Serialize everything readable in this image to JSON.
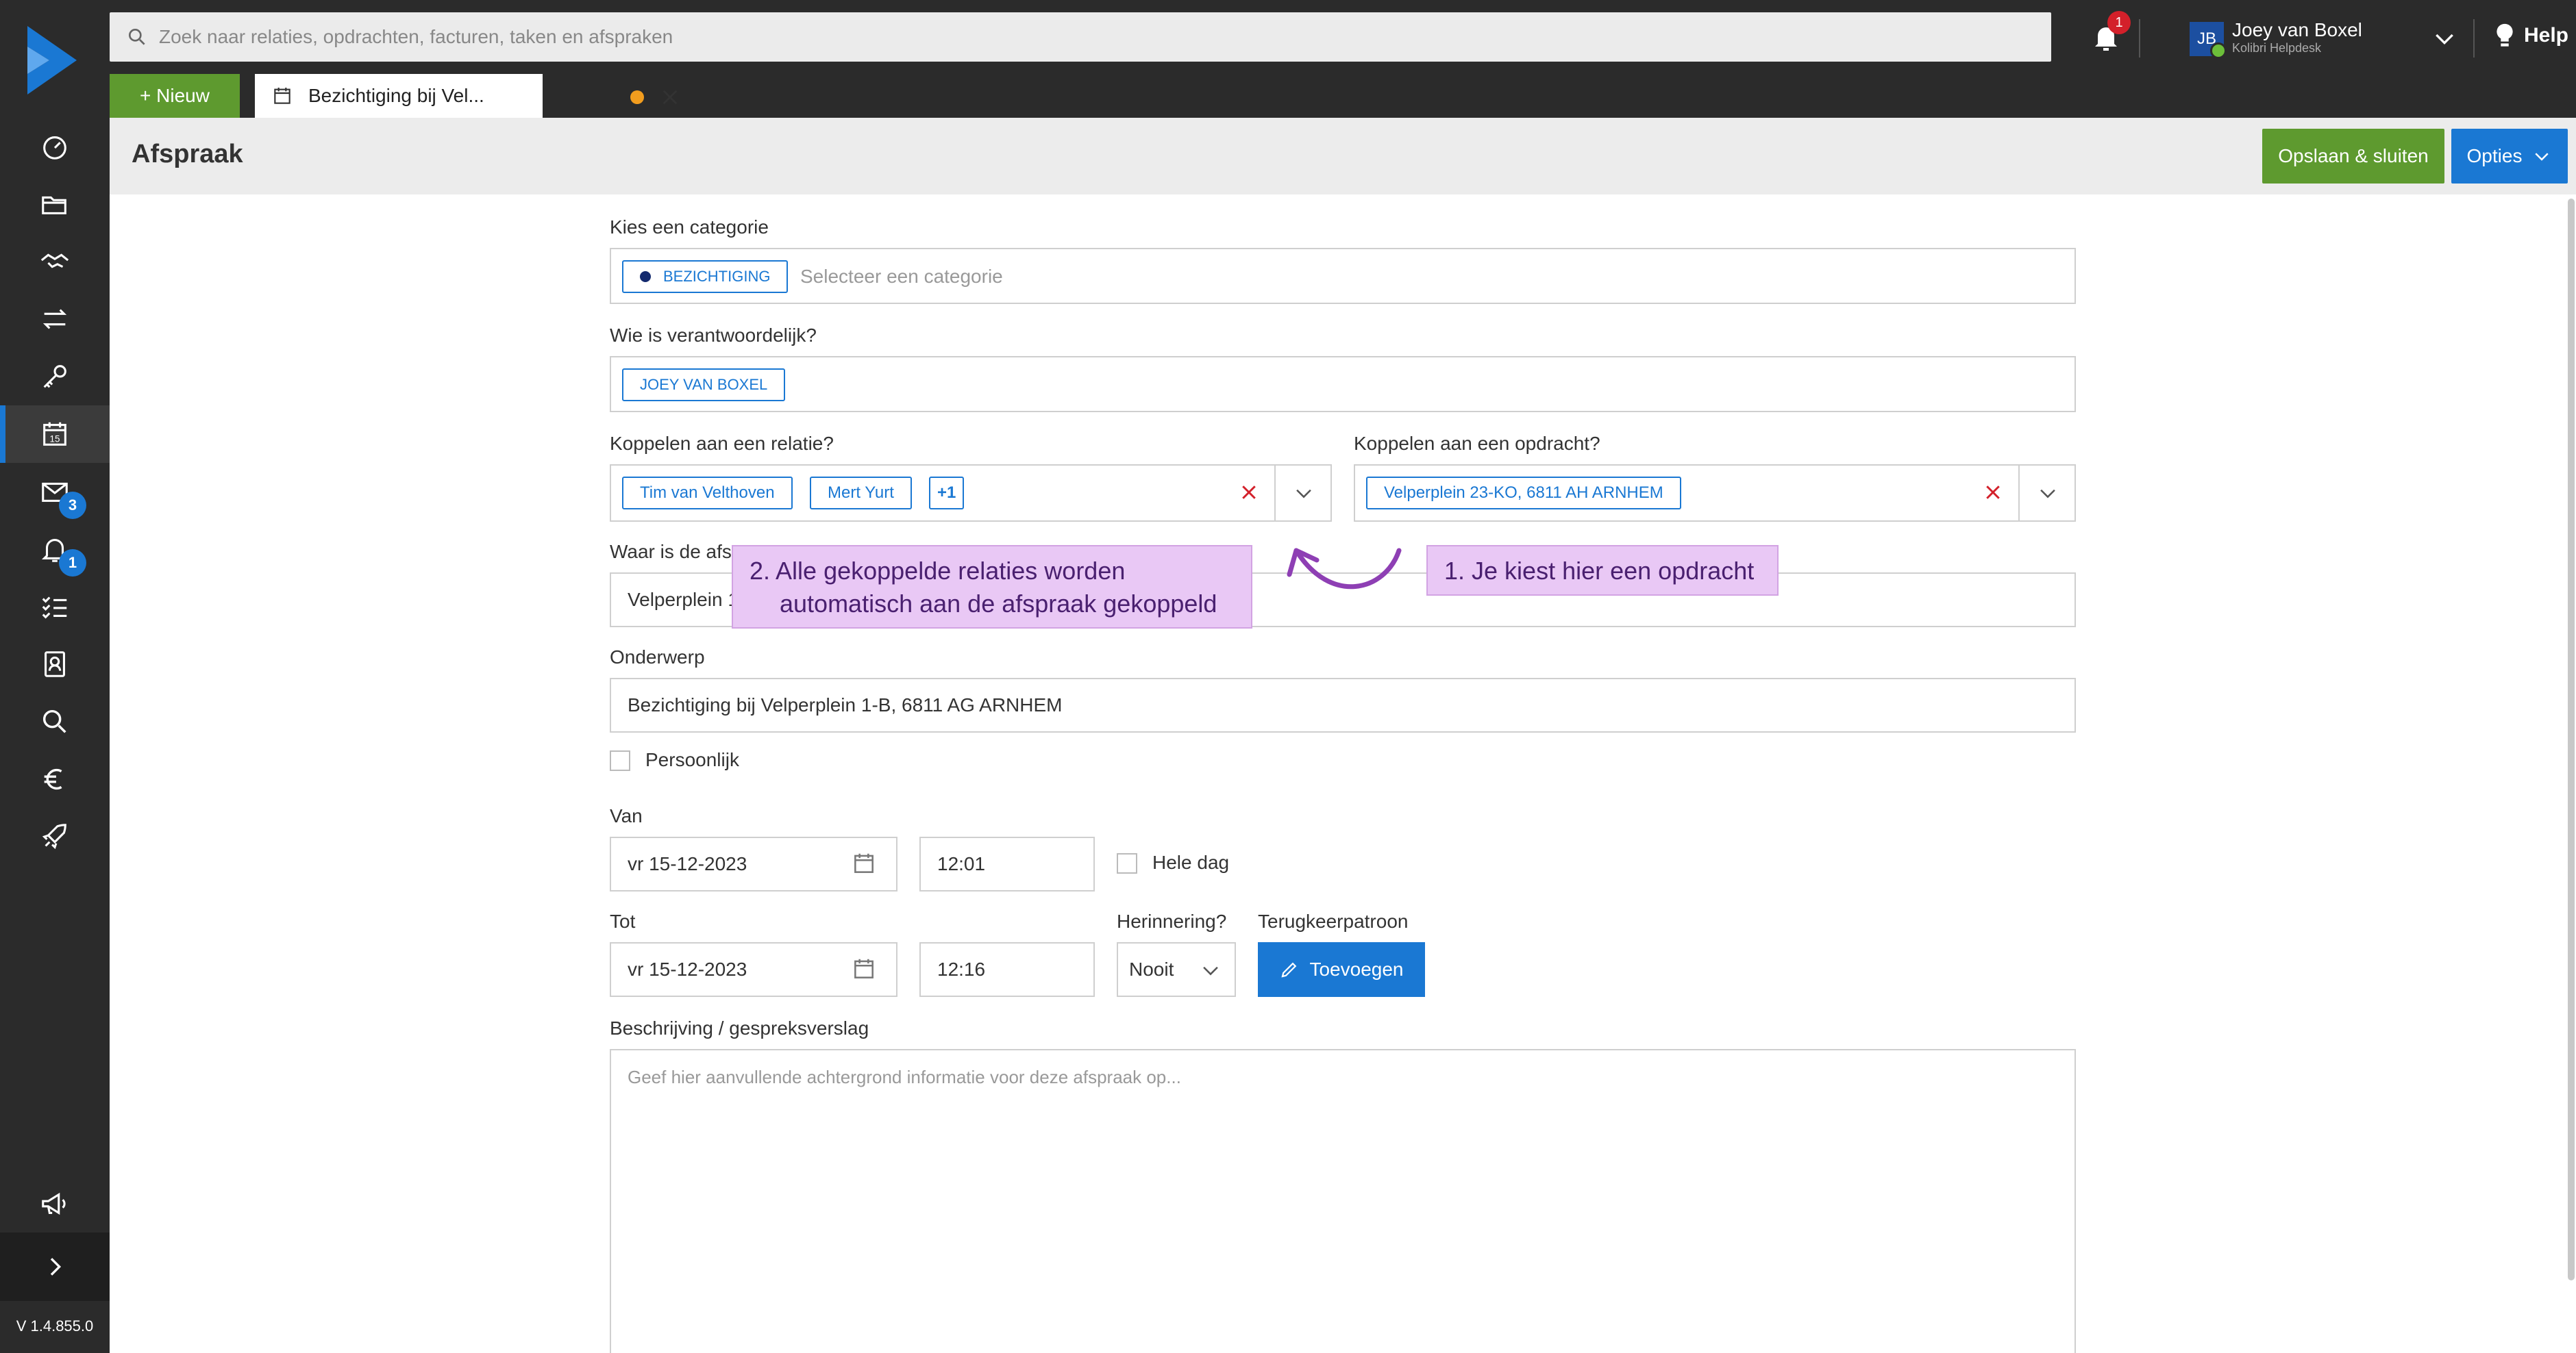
{
  "app": {
    "version": "V 1.4.855.0",
    "new_button": "+ Nieuw",
    "search_placeholder": "Zoek naar relaties, opdrachten, facturen, taken en afspraken",
    "help": "Help",
    "notifications_count": "1"
  },
  "user": {
    "initials": "JB",
    "name": "Joey van Boxel",
    "org": "Kolibri Helpdesk"
  },
  "sidebar": {
    "items": [
      {
        "icon": "dashboard-icon"
      },
      {
        "icon": "folder-icon"
      },
      {
        "icon": "handshake-icon"
      },
      {
        "icon": "transfer-icon"
      },
      {
        "icon": "key-icon"
      },
      {
        "icon": "calendar-icon",
        "active": true
      },
      {
        "icon": "mail-icon",
        "badge": "3"
      },
      {
        "icon": "bell-icon",
        "badge": "1"
      },
      {
        "icon": "tasks-icon"
      },
      {
        "icon": "contacts-icon"
      },
      {
        "icon": "search-icon"
      },
      {
        "icon": "euro-icon"
      },
      {
        "icon": "rocket-icon"
      },
      {
        "icon": "megaphone-icon"
      }
    ]
  },
  "tab": {
    "label": "Bezichtiging bij Vel..."
  },
  "page": {
    "title": "Afspraak",
    "save_button": "Opslaan & sluiten",
    "options_button": "Opties"
  },
  "form": {
    "category_label": "Kies een categorie",
    "category_chip": "BEZICHTIGING",
    "category_placeholder": "Selecteer een categorie",
    "responsible_label": "Wie is verantwoordelijk?",
    "responsible_chip": "JOEY VAN BOXEL",
    "relation_label": "Koppelen aan een relatie?",
    "relation_chips": [
      "Tim van Velthoven",
      "Mert Yurt",
      "+1"
    ],
    "assignment_label": "Koppelen aan een opdracht?",
    "assignment_chip": "Velperplein 23-KO, 6811 AH ARNHEM",
    "location_label": "Waar is de afsp",
    "location_value": "Velperplein 1",
    "subject_label": "Onderwerp",
    "subject_value": "Bezichtiging bij Velperplein 1-B, 6811 AG ARNHEM",
    "personal_label": "Persoonlijk",
    "from_label": "Van",
    "from_date": "vr 15-12-2023",
    "from_time": "12:01",
    "all_day_label": "Hele dag",
    "to_label": "Tot",
    "to_date": "vr 15-12-2023",
    "to_time": "12:16",
    "reminder_label": "Herinnering?",
    "reminder_value": "Nooit",
    "recurrence_label": "Terugkeerpatroon",
    "recurrence_button": "Toevoegen",
    "description_label": "Beschrijving / gespreksverslag",
    "description_placeholder": "Geef hier aanvullende achtergrond informatie voor deze afspraak op..."
  },
  "annotations": {
    "callout_2_line1": "2. Alle gekoppelde relaties worden",
    "callout_2_line2": "automatisch aan de afspraak gekoppeld",
    "callout_1": "1. Je kiest hier een opdracht",
    "callout_color": "#e9c8f5",
    "arrow_color": "#8e3fb4"
  },
  "colors": {
    "primary": "#1a78d3",
    "success": "#5e9a2f",
    "sidebar": "#2b2b2b",
    "danger": "#d3202a"
  }
}
